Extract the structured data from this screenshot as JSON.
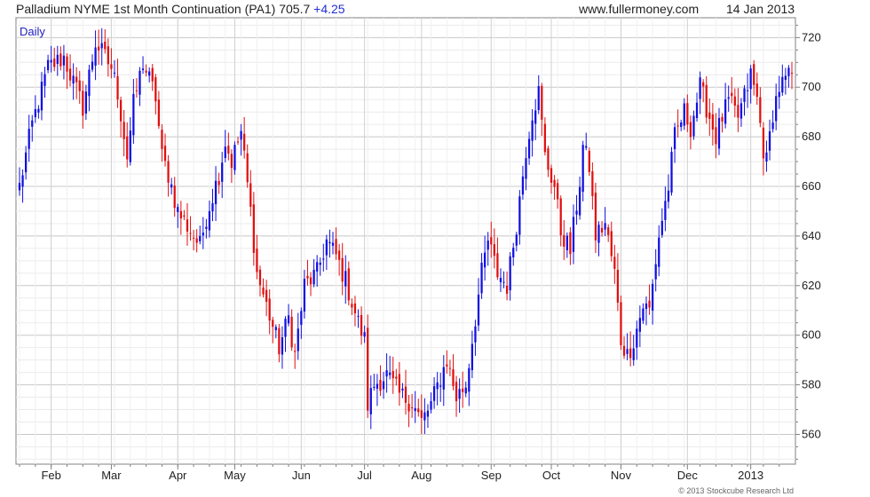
{
  "header": {
    "instrument": "Palladium NYME 1st Month Continuation (PA1)",
    "last": "705.7",
    "change": "+4.25",
    "site": "www.fullermoney.com",
    "date": "14 Jan 2013"
  },
  "footer": {
    "copyright": "© 2013 Stockcube Research Ltd"
  },
  "colors": {
    "up": "#1010e0",
    "down": "#e01010",
    "grid": "#d4d4d4",
    "frame": "#808080"
  },
  "chart_data": {
    "type": "candlestick",
    "interval_label": "Daily",
    "x_tick_labels": [
      "Feb",
      "Mar",
      "Apr",
      "May",
      "Jun",
      "Jul",
      "Aug",
      "Sep",
      "Oct",
      "Nov",
      "Dec",
      "2013"
    ],
    "x_tick_positions": [
      10,
      29,
      50,
      68,
      89,
      109,
      127,
      149,
      168,
      190,
      211,
      231
    ],
    "x_count": 245,
    "ylim": [
      548,
      728
    ],
    "y_ticks": [
      560,
      580,
      600,
      620,
      640,
      660,
      680,
      700,
      720
    ],
    "grid": true,
    "y_axis_side": "right",
    "close_series": [
      [
        0,
        660
      ],
      [
        4,
        685
      ],
      [
        9,
        708
      ],
      [
        14,
        712
      ],
      [
        20,
        692
      ],
      [
        24,
        718
      ],
      [
        29,
        708
      ],
      [
        31,
        698
      ],
      [
        34,
        672
      ],
      [
        36,
        693
      ],
      [
        39,
        710
      ],
      [
        43,
        696
      ],
      [
        45,
        672
      ],
      [
        47,
        665
      ],
      [
        50,
        650
      ],
      [
        54,
        642
      ],
      [
        57,
        636
      ],
      [
        59,
        648
      ],
      [
        63,
        665
      ],
      [
        65,
        678
      ],
      [
        67,
        670
      ],
      [
        70,
        682
      ],
      [
        73,
        650
      ],
      [
        75,
        625
      ],
      [
        78,
        612
      ],
      [
        82,
        595
      ],
      [
        85,
        607
      ],
      [
        87,
        592
      ],
      [
        90,
        620
      ],
      [
        94,
        625
      ],
      [
        97,
        638
      ],
      [
        100,
        632
      ],
      [
        103,
        622
      ],
      [
        107,
        605
      ],
      [
        109,
        598
      ],
      [
        110,
        572
      ],
      [
        112,
        580
      ],
      [
        116,
        584
      ],
      [
        120,
        576
      ],
      [
        124,
        573
      ],
      [
        127,
        565
      ],
      [
        130,
        572
      ],
      [
        133,
        583
      ],
      [
        135,
        590
      ],
      [
        138,
        575
      ],
      [
        141,
        580
      ],
      [
        143,
        598
      ],
      [
        146,
        625
      ],
      [
        148,
        638
      ],
      [
        151,
        625
      ],
      [
        154,
        620
      ],
      [
        157,
        645
      ],
      [
        160,
        675
      ],
      [
        162,
        690
      ],
      [
        164,
        698
      ],
      [
        166,
        672
      ],
      [
        169,
        660
      ],
      [
        171,
        642
      ],
      [
        174,
        634
      ],
      [
        177,
        662
      ],
      [
        178,
        676
      ],
      [
        180,
        668
      ],
      [
        182,
        640
      ],
      [
        185,
        645
      ],
      [
        188,
        625
      ],
      [
        190,
        598
      ],
      [
        192,
        592
      ],
      [
        194,
        598
      ],
      [
        197,
        612
      ],
      [
        199,
        610
      ],
      [
        202,
        640
      ],
      [
        205,
        660
      ],
      [
        207,
        680
      ],
      [
        210,
        690
      ],
      [
        212,
        684
      ],
      [
        215,
        700
      ],
      [
        218,
        688
      ],
      [
        220,
        680
      ],
      [
        222,
        688
      ],
      [
        224,
        694
      ],
      [
        227,
        688
      ],
      [
        229,
        696
      ],
      [
        231,
        705
      ],
      [
        233,
        695
      ],
      [
        235,
        675
      ],
      [
        236,
        670
      ],
      [
        238,
        690
      ],
      [
        240,
        700
      ],
      [
        244,
        705
      ]
    ],
    "last_close": 705.7
  }
}
